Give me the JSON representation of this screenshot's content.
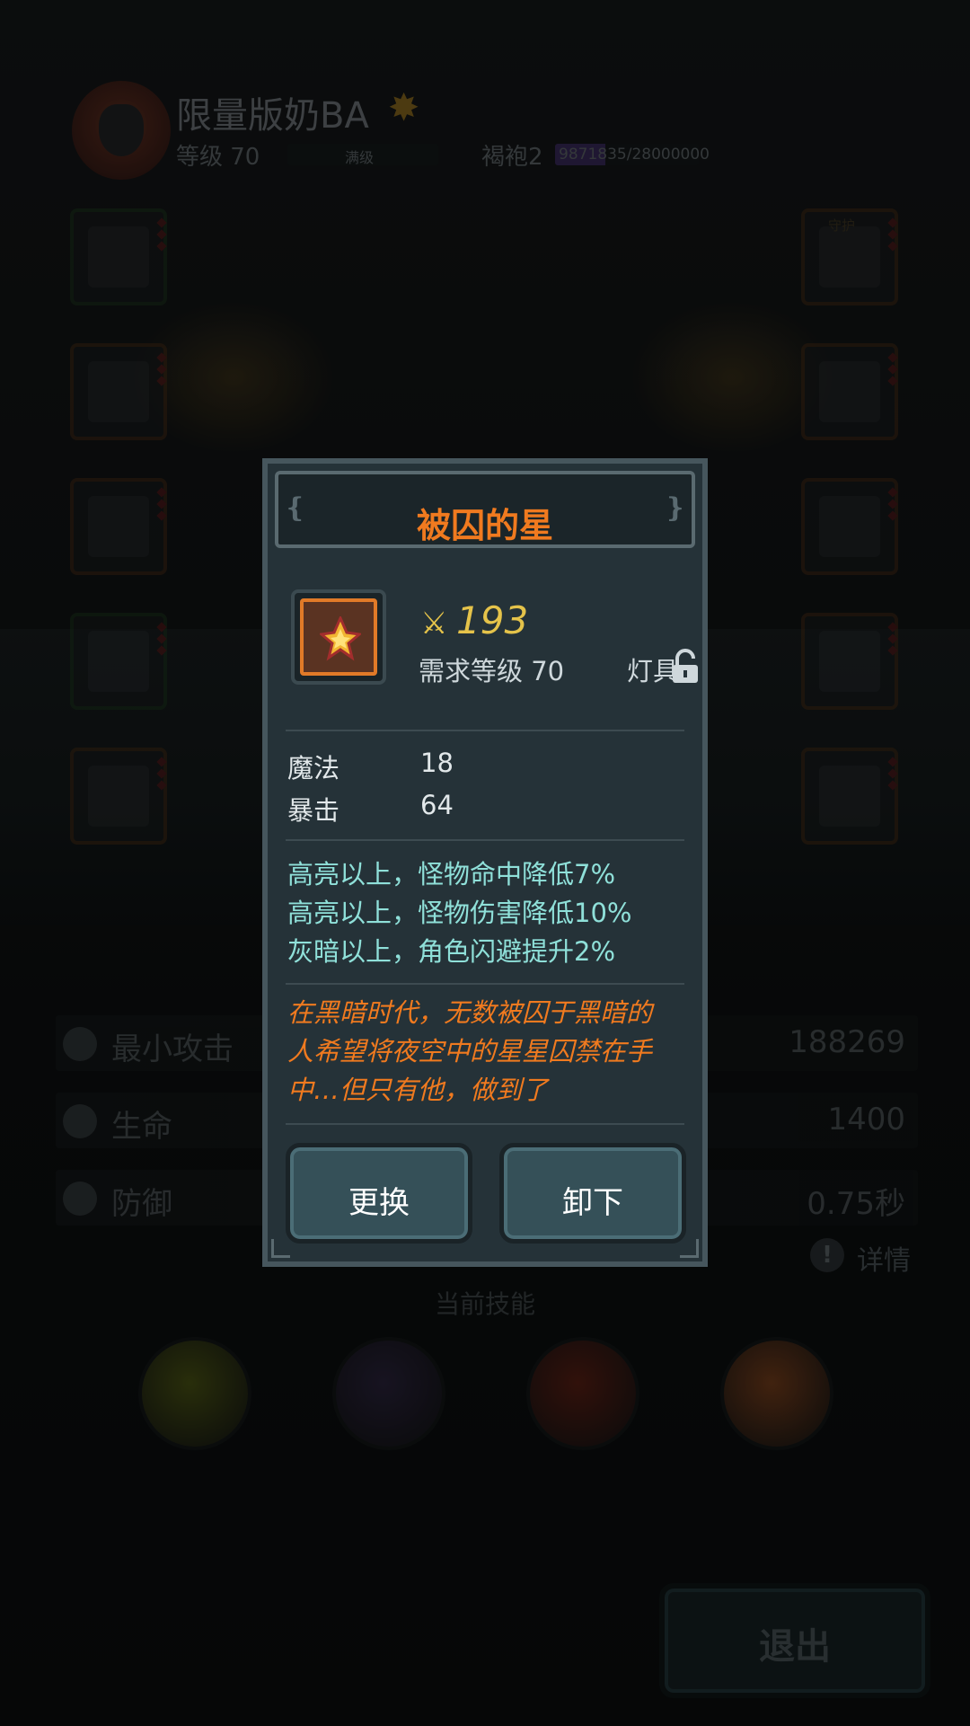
{
  "header": {
    "player_name": "限量版奶BA",
    "level_text": "等级 70",
    "level_bar_label": "满级",
    "class_text": "褐袍2",
    "exp_text": "9871835/28000000",
    "exp_progress": 0.3526
  },
  "slots": {
    "left": [
      "helmet",
      "armor",
      "boots",
      "weapon",
      "cloak"
    ],
    "right_tag": "守护",
    "right": [
      "guard",
      "ring",
      "necklace",
      "lamp",
      "charm"
    ]
  },
  "stats": [
    {
      "label": "最小攻击",
      "value": "188269",
      "icon": "attack-icon"
    },
    {
      "label": "生命",
      "value": "1400",
      "icon": "heart-icon"
    },
    {
      "label": "防御",
      "value": "0.75秒",
      "icon": "shield-icon"
    }
  ],
  "detail_label": "详情",
  "skills": {
    "title": "当前技能",
    "items": [
      {
        "name": "bubble-skill",
        "color": "#8a9a1a"
      },
      {
        "name": "lightning-skill",
        "color": "#4a3a6a"
      },
      {
        "name": "fire-vortex-skill",
        "color": "#a8321a"
      },
      {
        "name": "explosion-skill",
        "color": "#e0702a"
      }
    ]
  },
  "exit_label": "退出",
  "item": {
    "title": "被囚的星",
    "power": "193",
    "requirement": "需求等级 70",
    "slot_type": "灯具",
    "attributes": [
      {
        "name": "魔法",
        "value": "18"
      },
      {
        "name": "暴击",
        "value": "64"
      }
    ],
    "effects": [
      "高亮以上，怪物命中降低7%",
      "高亮以上，怪物伤害降低10%",
      "灰暗以上，角色闪避提升2%"
    ],
    "lore_lines": [
      "在黑暗时代，无数被囚于黑暗的",
      "人希望将夜空中的星星囚禁在手",
      "中…但只有他，做到了"
    ],
    "buttons": {
      "replace": "更换",
      "unequip": "卸下"
    }
  },
  "colors": {
    "title_orange": "#f07a1f",
    "power_gold": "#e5c34a",
    "effect_cyan": "#8fe0d9",
    "modal_bg": "#253238"
  }
}
